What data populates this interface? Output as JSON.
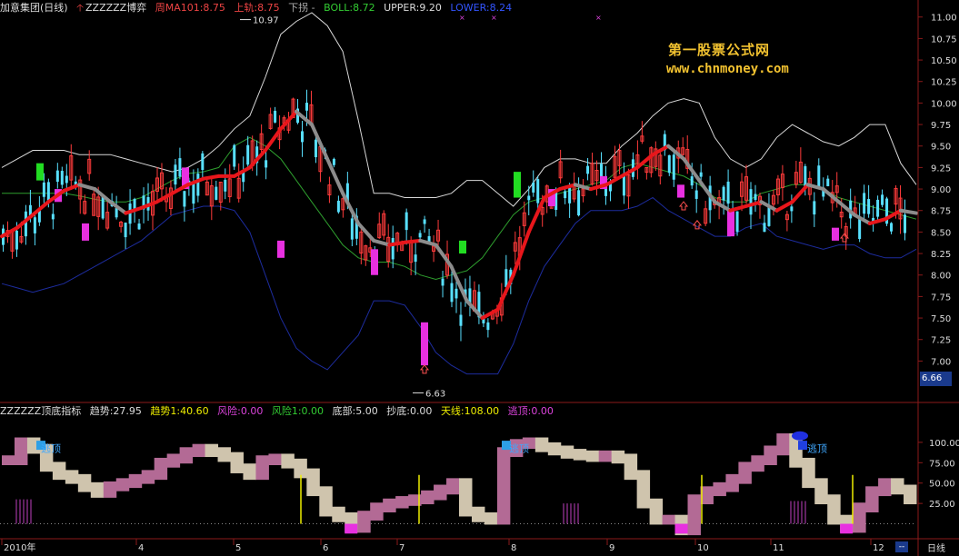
{
  "top_header": {
    "stock": "加意集团(日线)",
    "indicator": "ZZZZZZ博弈",
    "ma_label": "周MA101:8.75",
    "upper_track": "上轨:8.75",
    "lower_track": "下拐 -",
    "boll": "BOLL:8.72",
    "upper": "UPPER:9.20",
    "lower": "LOWER:8.24"
  },
  "bottom_header": {
    "name": "ZZZZZZ顶底指标",
    "trend": "趋势:27.95",
    "trend1": "趋势1:40.60",
    "risk": "风险:0.00",
    "risk1": "风险1:0.00",
    "bottom": "底部:5.00",
    "buy_bottom": "抄底:0.00",
    "sky": "天线:108.00",
    "escape": "逃顶:0.00"
  },
  "watermark": {
    "line1": "第一股票公式网",
    "line2": "www.chnmoney.com"
  },
  "current_price": "6.66",
  "period_label": "日线",
  "bottom_box": "--",
  "colors": {
    "up": "#ff3b3b",
    "down": "#58e0ff",
    "ma_red": "#e8161b",
    "ma_gray": "#8c8c8c",
    "boll_white": "#d8d8d8",
    "boll_blue": "#1d2c9e",
    "boll_mid": "#2e9e2e",
    "sig_green": "#22dd22",
    "sig_magenta": "#e830e0",
    "ind_pink": "#b36a95",
    "ind_tan": "#cfc4ad",
    "axis_red": "#8b1a1a"
  },
  "chart_data": [
    {
      "type": "candlestick",
      "y_axis_ticks": [
        11.0,
        10.75,
        10.5,
        10.25,
        10.0,
        9.75,
        9.5,
        9.25,
        9.0,
        8.75,
        8.5,
        8.25,
        8.0,
        7.75,
        7.5,
        7.25,
        7.0
      ],
      "ylim": [
        6.55,
        11.05
      ],
      "x_axis_labels": [
        "2010年",
        "4",
        "5",
        "6",
        "7",
        "8",
        "9",
        "10",
        "11",
        "12"
      ],
      "annotations": [
        {
          "text": "10.97",
          "value": 10.97
        },
        {
          "text": "6.63",
          "value": 6.63
        }
      ],
      "thick_ma": [
        8.45,
        8.55,
        8.7,
        8.85,
        8.98,
        9.05,
        9.0,
        8.85,
        8.72,
        8.78,
        8.85,
        8.95,
        9.05,
        9.12,
        9.15,
        9.15,
        9.25,
        9.45,
        9.7,
        9.9,
        9.75,
        9.35,
        8.95,
        8.6,
        8.4,
        8.35,
        8.38,
        8.4,
        8.35,
        8.1,
        7.7,
        7.5,
        7.6,
        8.0,
        8.5,
        8.9,
        9.0,
        9.05,
        9.0,
        9.05,
        9.15,
        9.25,
        9.4,
        9.5,
        9.35,
        9.1,
        8.85,
        8.75,
        8.8,
        8.85,
        8.75,
        8.85,
        9.05,
        9.0,
        8.85,
        8.7,
        8.6,
        8.65,
        8.75,
        8.72
      ],
      "boll_upper": [
        9.25,
        9.35,
        9.45,
        9.45,
        9.45,
        9.4,
        9.4,
        9.4,
        9.35,
        9.3,
        9.25,
        9.2,
        9.25,
        9.35,
        9.5,
        9.7,
        9.85,
        10.3,
        10.8,
        10.95,
        11.05,
        10.9,
        10.6,
        9.8,
        8.95,
        8.95,
        8.9,
        8.9,
        8.9,
        8.95,
        9.1,
        9.1,
        8.95,
        8.8,
        9.0,
        9.25,
        9.35,
        9.35,
        9.3,
        9.3,
        9.5,
        9.65,
        9.85,
        10.0,
        10.05,
        10.0,
        9.6,
        9.35,
        9.25,
        9.35,
        9.6,
        9.75,
        9.65,
        9.55,
        9.5,
        9.6,
        9.75,
        9.75,
        9.3,
        9.05
      ],
      "boll_mid": [
        8.95,
        8.95,
        8.95,
        8.95,
        8.95,
        8.92,
        8.88,
        8.85,
        8.85,
        8.9,
        9.0,
        9.1,
        9.18,
        9.2,
        9.25,
        9.5,
        9.6,
        9.5,
        9.35,
        9.1,
        8.85,
        8.6,
        8.35,
        8.2,
        8.15,
        8.15,
        8.1,
        8.0,
        7.95,
        8.0,
        8.05,
        8.2,
        8.45,
        8.7,
        8.85,
        8.9,
        8.95,
        9.0,
        9.05,
        9.1,
        9.25,
        9.3,
        9.25,
        9.2,
        9.15,
        9.05,
        8.9,
        8.85,
        8.85,
        8.95,
        9.0,
        9.05,
        9.05,
        9.0,
        8.9,
        8.85,
        8.8,
        8.75,
        8.7,
        8.65
      ],
      "boll_lower": [
        7.9,
        7.85,
        7.8,
        7.85,
        7.9,
        8.0,
        8.1,
        8.2,
        8.3,
        8.4,
        8.55,
        8.7,
        8.75,
        8.8,
        8.8,
        8.75,
        8.5,
        8.0,
        7.5,
        7.15,
        7.0,
        6.9,
        7.1,
        7.3,
        7.7,
        7.7,
        7.65,
        7.4,
        7.1,
        6.95,
        6.85,
        6.85,
        6.85,
        7.2,
        7.7,
        8.1,
        8.35,
        8.6,
        8.75,
        8.75,
        8.75,
        8.8,
        8.9,
        8.75,
        8.65,
        8.55,
        8.45,
        8.45,
        8.55,
        8.6,
        8.45,
        8.4,
        8.35,
        8.3,
        8.35,
        8.35,
        8.25,
        8.2,
        8.2,
        8.3
      ]
    },
    {
      "type": "area",
      "y_axis_ticks": [
        100.0,
        75.0,
        50.0,
        25.0
      ],
      "ylim": [
        -15,
        130
      ],
      "annotations": [
        "逃顶",
        "逃顶",
        "逃顶"
      ],
      "values": [
        78,
        100,
        92,
        70,
        60,
        55,
        45,
        38,
        46,
        50,
        55,
        60,
        75,
        80,
        88,
        92,
        88,
        82,
        68,
        60,
        78,
        80,
        74,
        62,
        40,
        15,
        8,
        -5,
        10,
        20,
        25,
        28,
        30,
        35,
        42,
        50,
        15,
        8,
        5,
        88,
        98,
        100,
        94,
        90,
        86,
        84,
        82,
        84,
        80,
        60,
        25,
        5,
        5,
        -8,
        30,
        40,
        45,
        55,
        70,
        78,
        90,
        105,
        75,
        50,
        30,
        5,
        -5,
        20,
        40,
        50,
        42,
        30
      ]
    }
  ]
}
